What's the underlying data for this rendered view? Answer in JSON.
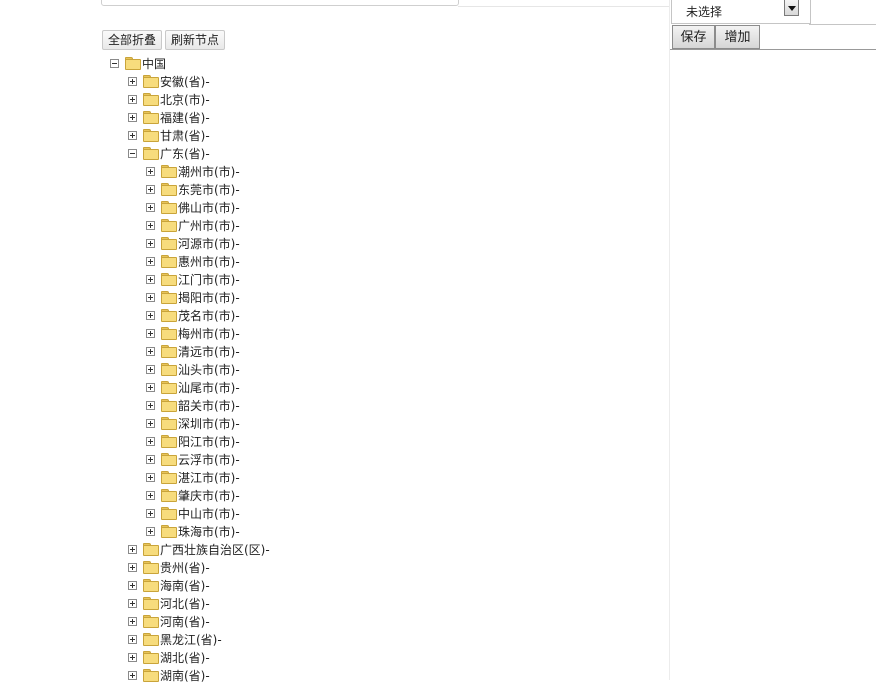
{
  "toolbar": {
    "collapse_all_label": "全部折叠",
    "refresh_node_label": "刷新节点"
  },
  "right_panel": {
    "select_value": "未选择",
    "save_label": "保存",
    "add_label": "增加"
  },
  "tree": {
    "root": "中国",
    "provinces_before": [
      "安徽(省)-",
      "北京(市)-",
      "福建(省)-",
      "甘肃(省)-"
    ],
    "expanded_province": "广东(省)-",
    "cities": [
      "潮州市(市)-",
      "东莞市(市)-",
      "佛山市(市)-",
      "广州市(市)-",
      "河源市(市)-",
      "惠州市(市)-",
      "江门市(市)-",
      "揭阳市(市)-",
      "茂名市(市)-",
      "梅州市(市)-",
      "清远市(市)-",
      "汕头市(市)-",
      "汕尾市(市)-",
      "韶关市(市)-",
      "深圳市(市)-",
      "阳江市(市)-",
      "云浮市(市)-",
      "湛江市(市)-",
      "肇庆市(市)-",
      "中山市(市)-",
      "珠海市(市)-"
    ],
    "provinces_after": [
      "广西壮族自治区(区)-",
      "贵州(省)-",
      "海南(省)-",
      "河北(省)-",
      "河南(省)-",
      "黑龙江(省)-",
      "湖北(省)-",
      "湖南(省)-"
    ]
  }
}
